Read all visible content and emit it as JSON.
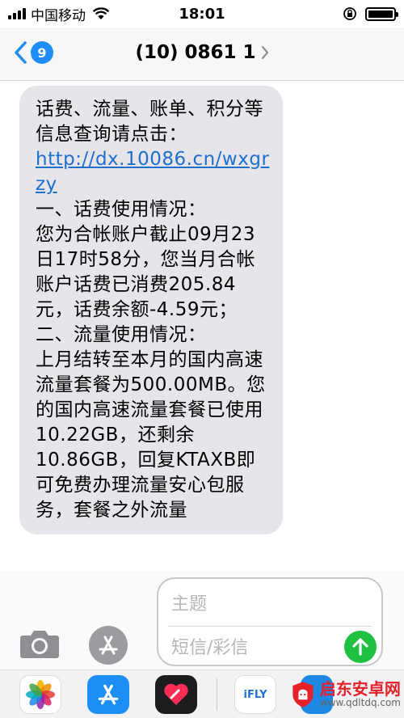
{
  "status_bar": {
    "carrier": "中国移动",
    "time": "18:01"
  },
  "nav": {
    "back_badge": "9",
    "title": "(10) 0861 1"
  },
  "message": {
    "line_intro": "话费、流量、账单、积分等信息查询请点击：",
    "link": "http://dx.10086.cn/wxgrzy",
    "section1_heading": "一、话费使用情况：",
    "section1_body": "您为合帐账户截止09月23日17时58分，您当月合帐账户话费已消费205.84元，话费余额-4.59元；",
    "section2_heading": "二、流量使用情况：",
    "section2_body": "上月结转至本月的国内高速流量套餐为500.00MB。您的国内高速流量套餐已使用10.22GB，还剩余10.86GB，回复KTAXB即可免费办理流量安心包服务，套餐之外流量"
  },
  "compose": {
    "subject_placeholder": "主题",
    "message_placeholder": "短信/彩信"
  },
  "app_drawer": {
    "apps": [
      "photos-app",
      "app-store-app",
      "digital-touch-app",
      "ifly-app",
      "app-partial"
    ],
    "ifly_label": "iFLY"
  },
  "watermark": {
    "title": "启东安卓网",
    "url": "www.qdltdq.com"
  },
  "colors": {
    "accent_blue": "#1f8df9",
    "bubble_gray": "#e5e5ea",
    "send_green": "#1fc140",
    "link_blue": "#1f6fd1"
  }
}
